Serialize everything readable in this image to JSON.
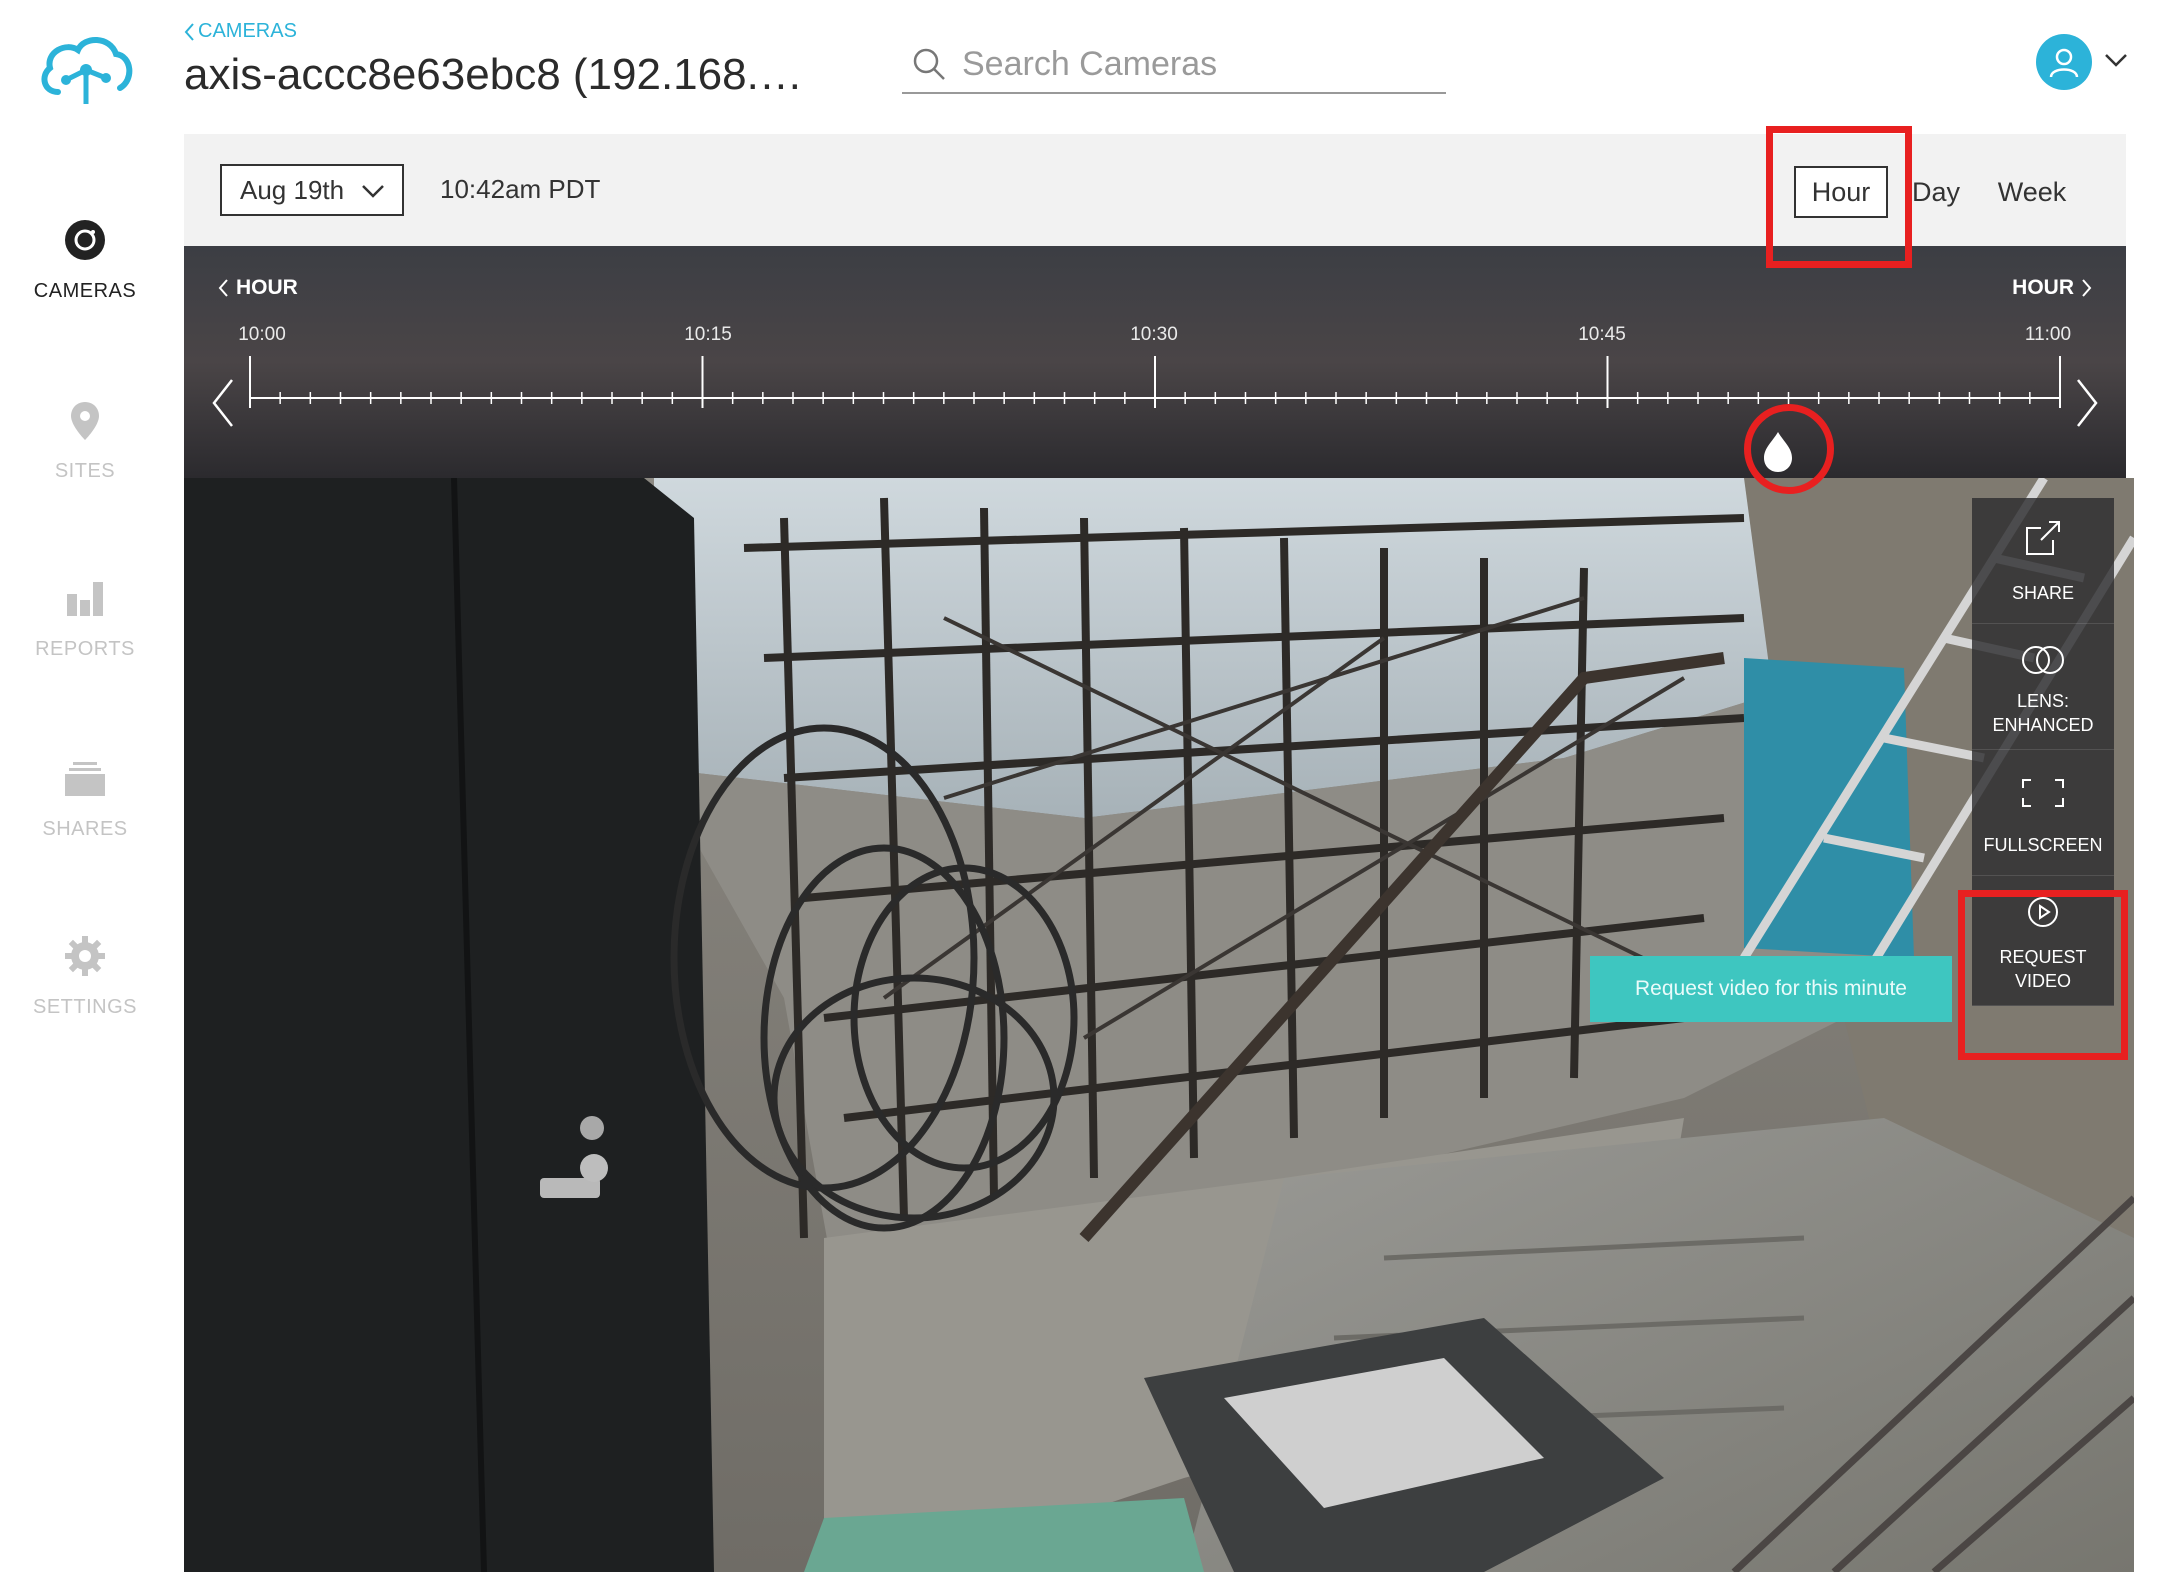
{
  "header": {
    "back_label": "CAMERAS",
    "title": "axis-accc8e63ebc8 (192.168.…",
    "search_placeholder": "Search Cameras",
    "brand_color": "#2cb3d9"
  },
  "sidebar": {
    "items": [
      {
        "label": "CAMERAS",
        "icon": "camera-icon",
        "active": true
      },
      {
        "label": "SITES",
        "icon": "location-pin-icon",
        "active": false
      },
      {
        "label": "REPORTS",
        "icon": "bar-chart-icon",
        "active": false
      },
      {
        "label": "SHARES",
        "icon": "stack-icon",
        "active": false
      },
      {
        "label": "SETTINGS",
        "icon": "gear-icon",
        "active": false
      }
    ]
  },
  "toolbar": {
    "date": "Aug 19th",
    "time": "10:42am PDT",
    "ranges": [
      "Hour",
      "Day",
      "Week"
    ],
    "selected_range": "Hour"
  },
  "timeline": {
    "prev_label": "HOUR",
    "next_label": "HOUR",
    "ticks": [
      "10:00",
      "10:15",
      "10:30",
      "10:45",
      "11:00"
    ]
  },
  "controls": [
    {
      "label": "SHARE",
      "icon": "share-icon"
    },
    {
      "label": "LENS:",
      "label2": "ENHANCED",
      "icon": "lens-icon"
    },
    {
      "label": "FULLSCREEN",
      "icon": "fullscreen-icon"
    },
    {
      "label": "REQUEST",
      "label2": "VIDEO",
      "icon": "play-circle-icon"
    }
  ],
  "tooltip": "Request video for this minute",
  "highlight_color": "#e82020",
  "tooltip_color": "#3ec6c0"
}
